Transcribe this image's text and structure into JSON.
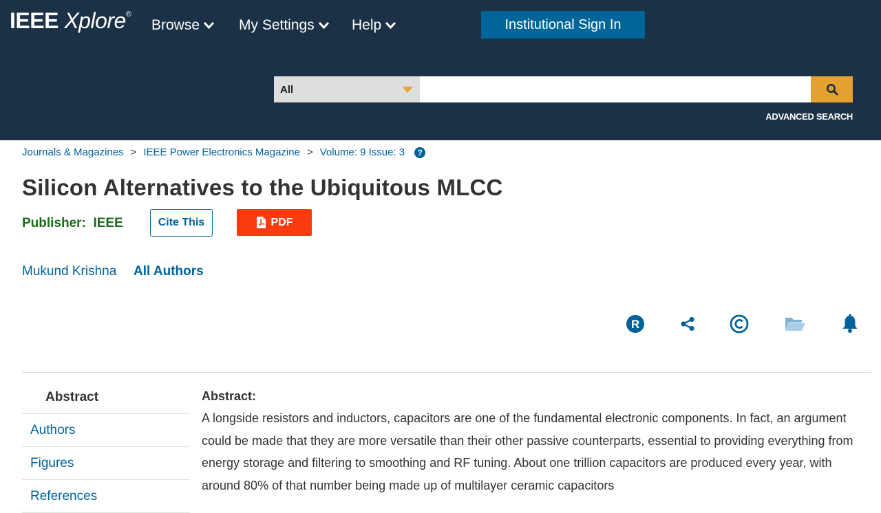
{
  "header": {
    "logo_brand": "IEEE",
    "logo_product": "Xplore",
    "logo_mark": "®",
    "nav": [
      {
        "label": "Browse",
        "icon": "chevron-down-icon"
      },
      {
        "label": "My Settings",
        "icon": "chevron-down-icon"
      },
      {
        "label": "Help",
        "icon": "chevron-down-icon"
      }
    ],
    "signin_label": "Institutional Sign In",
    "search": {
      "scope": "All",
      "value": "",
      "placeholder": "",
      "button_icon": "search-icon"
    },
    "advanced_search": "ADVANCED SEARCH"
  },
  "breadcrumb": {
    "items": [
      "Journals & Magazines",
      "IEEE Power Electronics Magazine",
      "Volume: 9 Issue: 3"
    ],
    "separator": ">",
    "help_icon": "question-circle-icon",
    "help_glyph": "?"
  },
  "article": {
    "title": "Silicon Alternatives to the Ubiquitous MLCC",
    "publisher_label": "Publisher:",
    "publisher": "IEEE",
    "cite_label": "Cite This",
    "pdf_label": "PDF",
    "author": "Mukund Krishna",
    "all_authors": "All Authors"
  },
  "tools": [
    {
      "icon": "rights-r-icon",
      "glyph": "R"
    },
    {
      "icon": "share-icon"
    },
    {
      "icon": "copyright-icon",
      "glyph": "©"
    },
    {
      "icon": "folder-open-icon"
    },
    {
      "icon": "bell-icon"
    }
  ],
  "sidenav": {
    "items": [
      "Abstract",
      "Authors",
      "Figures",
      "References"
    ],
    "active": "Abstract"
  },
  "abstract": {
    "heading": "Abstract:",
    "text": "A longside resistors and inductors, capacitors are one of the fundamental electronic components. In fact, an argument could be made that they are more versatile than their other passive counterparts, essential to providing everything from energy storage and filtering to smoothing and RF tuning. About one trillion capacitors are produced every year, with around 80% of that number being made up of multilayer ceramic capacitors"
  },
  "colors": {
    "header_bg": "#1b3146",
    "link": "#00629b",
    "signin_bg": "#006699",
    "search_btn": "#e4a031",
    "pdf_bg": "#f93b0f",
    "publisher_green": "#1a6b18"
  }
}
